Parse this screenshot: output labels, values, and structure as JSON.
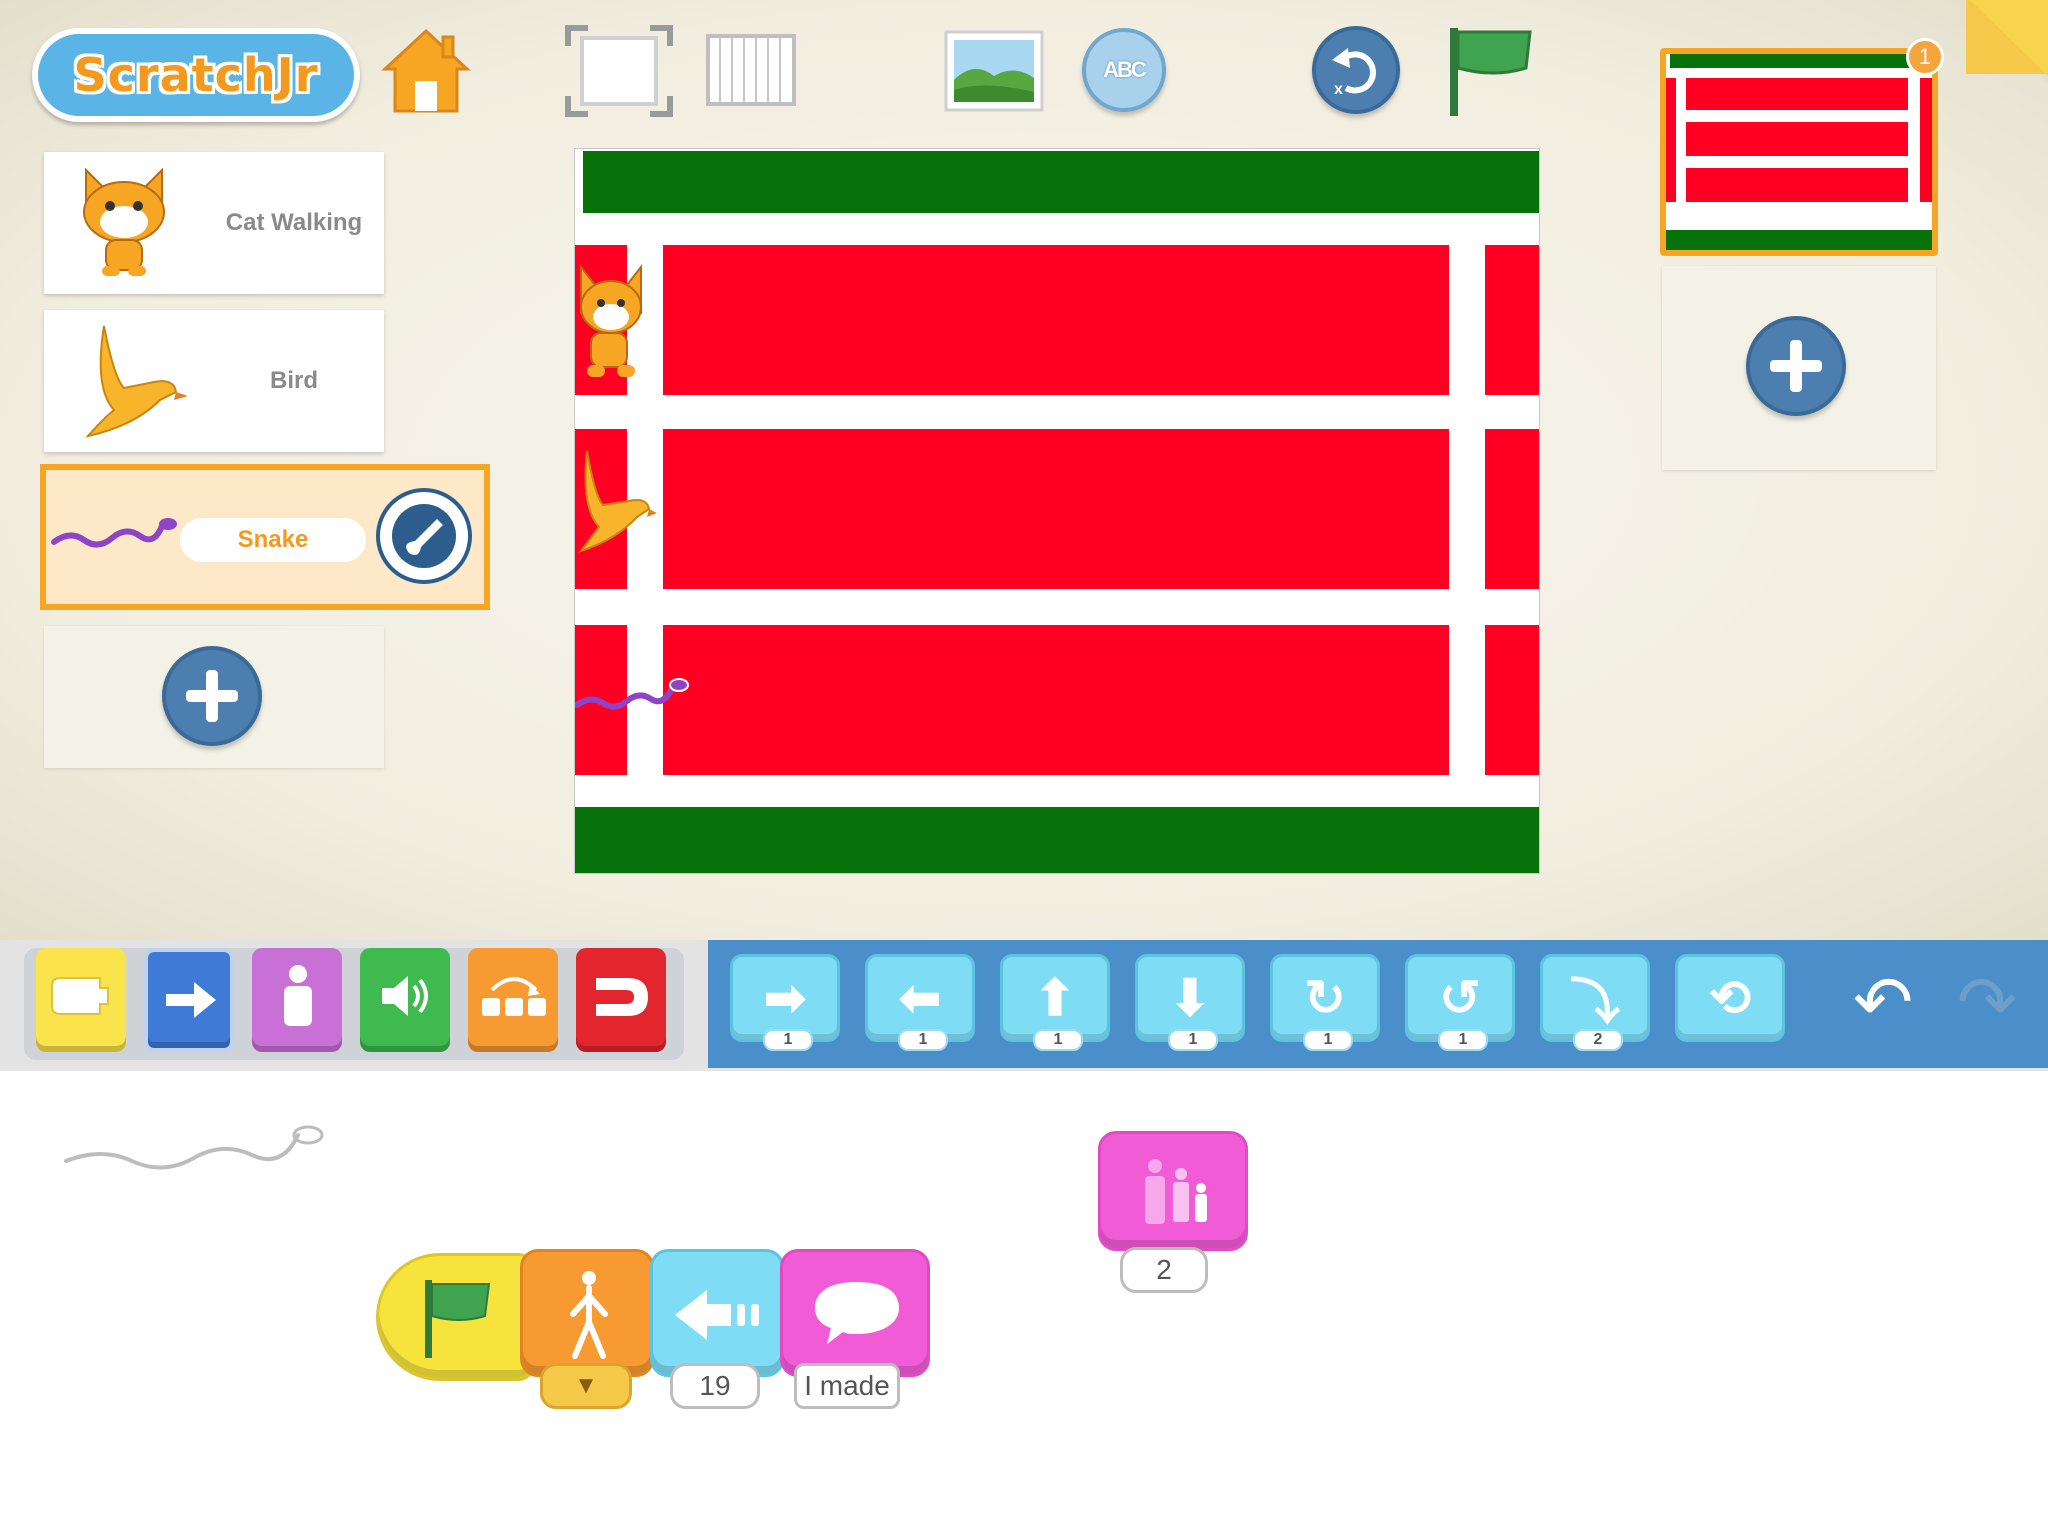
{
  "app": {
    "logo_text": "ScratchJr"
  },
  "toolbar": {
    "home_icon": "home-icon",
    "fullscreen_icon": "presentation-mode-icon",
    "grid_icon": "grid-icon",
    "background_icon": "change-background-icon",
    "text_icon": "add-text-icon",
    "text_glyph": "ABC",
    "reset_icon": "reset-characters-icon",
    "green_flag_icon": "green-flag-icon"
  },
  "sprites": [
    {
      "name": "Cat Walking",
      "icon": "cat-icon",
      "selected": false
    },
    {
      "name": "Bird",
      "icon": "bird-icon",
      "selected": false
    },
    {
      "name": "Snake",
      "icon": "snake-icon",
      "selected": true
    }
  ],
  "pages": [
    {
      "number": "1",
      "selected": true
    }
  ],
  "colors": {
    "stage_green": "#08720a",
    "stage_red": "#ff0022",
    "selection_orange": "#f6a623",
    "motion_blue": "#4a8fc9"
  },
  "categories": [
    {
      "name": "Triggering",
      "color": "#fbe34c"
    },
    {
      "name": "Motion",
      "color": "#3f7bd6"
    },
    {
      "name": "Looks",
      "color": "#c870d6"
    },
    {
      "name": "Sound",
      "color": "#3fba4f"
    },
    {
      "name": "Control",
      "color": "#f79a32"
    },
    {
      "name": "End",
      "color": "#e3262d"
    }
  ],
  "motion_blocks": [
    {
      "icon": "move-right-icon",
      "glyph": "➡",
      "value": "1"
    },
    {
      "icon": "move-left-icon",
      "glyph": "⬅",
      "value": "1"
    },
    {
      "icon": "move-up-icon",
      "glyph": "⬆",
      "value": "1"
    },
    {
      "icon": "move-down-icon",
      "glyph": "⬇",
      "value": "1"
    },
    {
      "icon": "turn-right-icon",
      "glyph": "↻",
      "value": "1"
    },
    {
      "icon": "turn-left-icon",
      "glyph": "↺",
      "value": "1"
    },
    {
      "icon": "hop-icon",
      "glyph": "⤵",
      "value": "2"
    },
    {
      "icon": "go-home-icon",
      "glyph": "⟲",
      "value": ""
    }
  ],
  "edit": {
    "undo_glyph": "↶",
    "redo_glyph": "↷"
  },
  "script": {
    "blocks": [
      {
        "type": "green-flag-start",
        "icon": "green-flag-icon",
        "param": ""
      },
      {
        "type": "set-speed",
        "icon": "walking-person-icon",
        "param": "▼"
      },
      {
        "type": "move-left",
        "icon": "move-left-icon",
        "param": "19"
      },
      {
        "type": "say",
        "icon": "speech-bubble-icon",
        "param": "I made"
      }
    ],
    "loose_block": {
      "type": "grow",
      "icon": "grow-icon",
      "param": "2"
    }
  }
}
